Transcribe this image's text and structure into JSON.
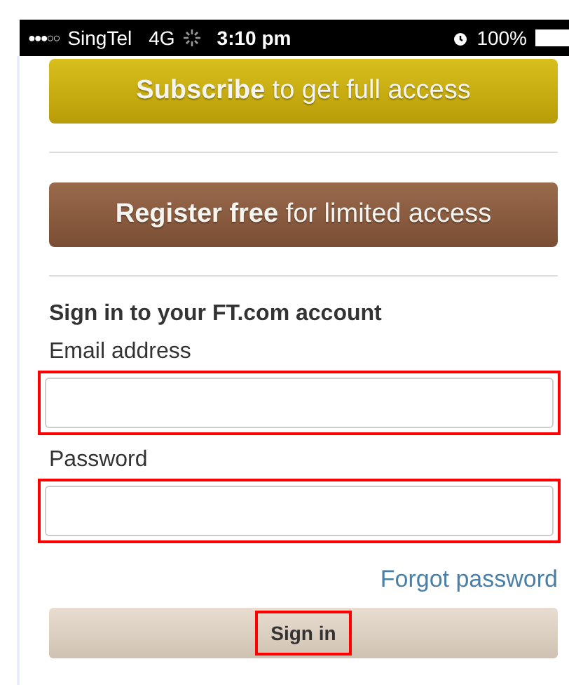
{
  "status_bar": {
    "signal": "●●●○○",
    "carrier": "SingTel",
    "network": "4G",
    "time": "3:10 pm",
    "battery": "100%"
  },
  "offers": [
    {
      "kind": "subscribe",
      "label": "**Subscribe** to get full access"
    },
    {
      "kind": "register",
      "label": "**Register free** for limited access"
    }
  ],
  "sign_in": {
    "heading": "Sign in to your FT.com account",
    "fields": [
      {
        "label": "Email address",
        "highlighted": true
      },
      {
        "label": "Password",
        "highlighted": true
      }
    ],
    "forgot_link": "Forgot password",
    "button": {
      "label": "Sign in",
      "highlighted": true
    }
  }
}
